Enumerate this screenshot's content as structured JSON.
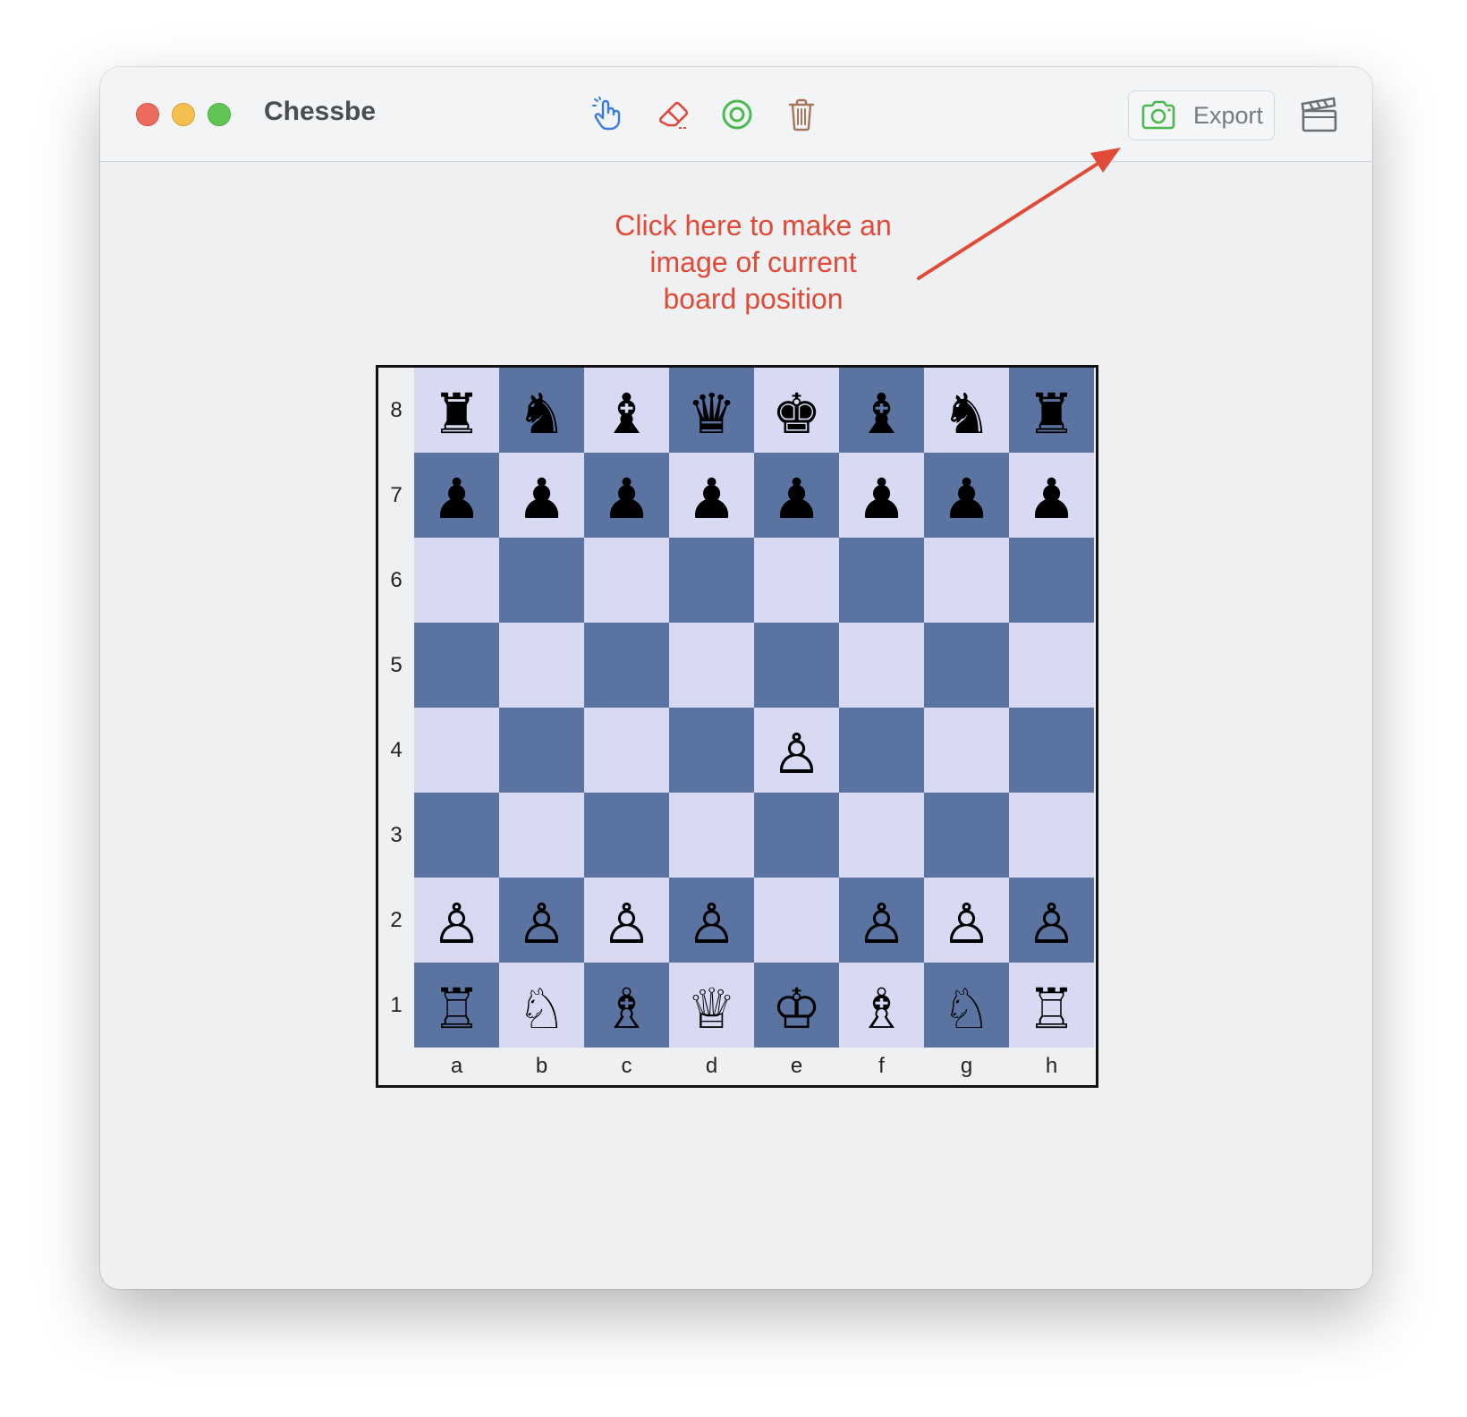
{
  "window": {
    "title": "Chessbe"
  },
  "toolbar": {
    "tools": [
      {
        "name": "hand-pointer-icon",
        "color": "#3a7be0"
      },
      {
        "name": "eraser-icon",
        "color": "#e0483c"
      },
      {
        "name": "target-icon",
        "color": "#4db84e"
      },
      {
        "name": "trash-icon",
        "color": "#a7765a"
      }
    ],
    "export_label": "Export",
    "export_icon": "camera-icon",
    "export_icon_color": "#4db84e",
    "extra_icon": "clapperboard-icon"
  },
  "annotation": {
    "lines": [
      "Click here to make an",
      "image of current",
      "board position"
    ],
    "color": "#e04a36"
  },
  "board": {
    "light_color": "#d8d9f2",
    "dark_color": "#5b73a1",
    "files": [
      "a",
      "b",
      "c",
      "d",
      "e",
      "f",
      "g",
      "h"
    ],
    "ranks": [
      "8",
      "7",
      "6",
      "5",
      "4",
      "3",
      "2",
      "1"
    ],
    "rows": [
      [
        "♜",
        "♞",
        "♝",
        "♛",
        "♚",
        "♝",
        "♞",
        "♜"
      ],
      [
        "♟",
        "♟",
        "♟",
        "♟",
        "♟",
        "♟",
        "♟",
        "♟"
      ],
      [
        "",
        "",
        "",
        "",
        "",
        "",
        "",
        ""
      ],
      [
        "",
        "",
        "",
        "",
        "",
        "",
        "",
        ""
      ],
      [
        "",
        "",
        "",
        "",
        "♙",
        "",
        "",
        ""
      ],
      [
        "",
        "",
        "",
        "",
        "",
        "",
        "",
        ""
      ],
      [
        "♙",
        "♙",
        "♙",
        "♙",
        "",
        "♙",
        "♙",
        "♙"
      ],
      [
        "♖",
        "♘",
        "♗",
        "♕",
        "♔",
        "♗",
        "♘",
        "♖"
      ]
    ]
  }
}
